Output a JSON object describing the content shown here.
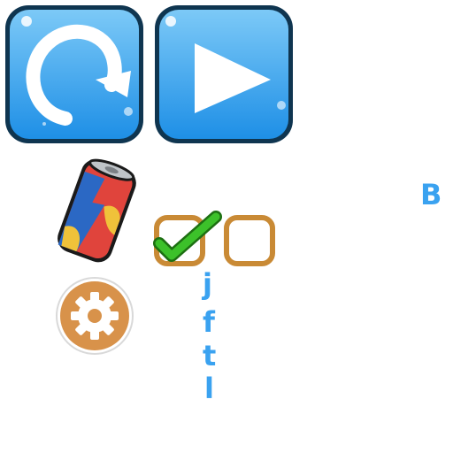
{
  "sprite_sheet": {
    "buttons": {
      "restart": {
        "icon": "restart-arrow-icon"
      },
      "play": {
        "icon": "play-triangle-icon"
      }
    },
    "items": {
      "soda_can": {
        "icon": "soda-can-icon"
      },
      "settings": {
        "icon": "gear-icon"
      }
    },
    "checkboxes": [
      {
        "state": "checked",
        "icon": "checkmark-icon"
      },
      {
        "state": "unchecked"
      }
    ],
    "font_glyphs": {
      "capital": "B",
      "column": [
        "j",
        "f",
        "t",
        "l"
      ]
    },
    "colors": {
      "button_blue": "#2f9bea",
      "button_border": "#0f3550",
      "checkbox_orange": "#c98a35",
      "check_green": "#3cc12a",
      "gear_orange": "#d8924a",
      "glyph_blue": "#3aa2f0"
    }
  }
}
